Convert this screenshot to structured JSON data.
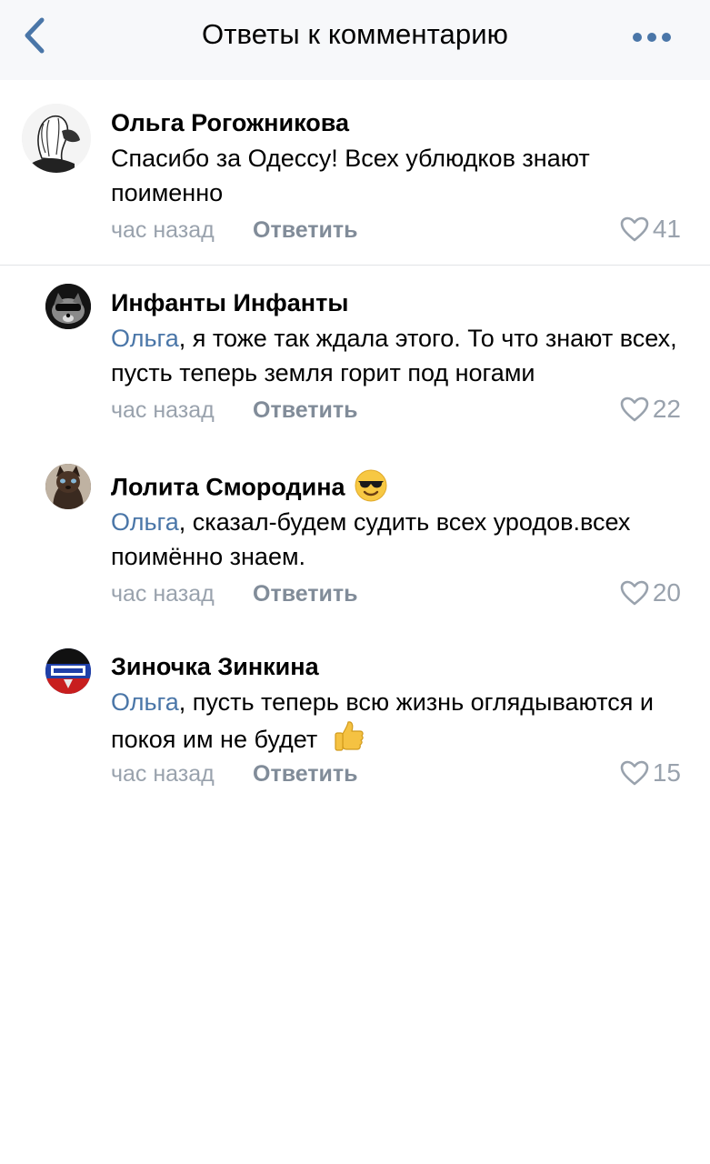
{
  "header": {
    "title": "Ответы к комментарию",
    "back_icon": "chevron-left-icon",
    "more_icon": "more-horizontal-icon",
    "accent_color": "#4a76a8"
  },
  "comments": [
    {
      "author": "Ольга Рогожникова",
      "text": "Спасибо за Одессу! Всех ублюдков знают поименно",
      "time": "час назад",
      "reply_label": "Ответить",
      "likes": "41"
    },
    {
      "author": "Инфанты Инфанты",
      "mention": "Ольга",
      "text": ", я тоже так ждала этого. То что знают всех, пусть теперь земля горит под ногами",
      "time": "час назад",
      "reply_label": "Ответить",
      "likes": "22"
    },
    {
      "author": "Лолита Смородина",
      "author_emoji": "sunglasses-emoji",
      "mention": "Ольга",
      "text": ", сказал-будем судить всех уродов.всех поимённо знаем.",
      "time": "час назад",
      "reply_label": "Ответить",
      "likes": "20"
    },
    {
      "author": "Зиночка Зинкина",
      "mention": "Ольга",
      "text": ", пусть теперь всю жизнь оглядываются и покоя им не будет",
      "text_emoji": "thumbs-up-emoji",
      "time": "час назад",
      "reply_label": "Ответить",
      "likes": "15"
    }
  ]
}
